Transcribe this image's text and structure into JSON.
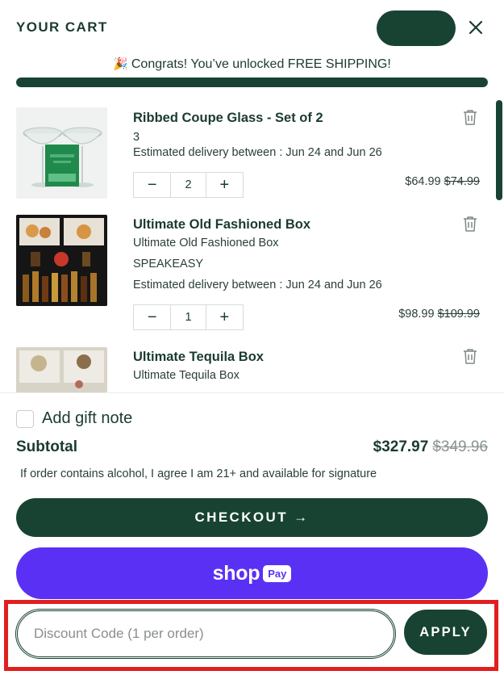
{
  "header": {
    "title": "YOUR CART",
    "close_icon": "close-icon"
  },
  "shipping": {
    "emoji": "🎉",
    "message": "Congrats! You’ve unlocked FREE SHIPPING!",
    "progress_fraction": 1.0
  },
  "items": [
    {
      "name": "Ribbed Coupe Glass - Set of 2",
      "line1": "3",
      "line2": "Estimated delivery between : Jun 24 and Jun 26",
      "quantity": "2",
      "price": "$64.99",
      "compare_price": "$74.99",
      "minus": "−",
      "plus": "+"
    },
    {
      "name": "Ultimate Old Fashioned Box",
      "line1": "Ultimate Old Fashioned Box",
      "line2": "SPEAKEASY",
      "line3": "Estimated delivery between : Jun 24 and Jun 26",
      "quantity": "1",
      "price": "$98.99",
      "compare_price": "$109.99",
      "minus": "−",
      "plus": "+"
    },
    {
      "name": "Ultimate Tequila Box",
      "line1": "Ultimate Tequila Box"
    }
  ],
  "footer": {
    "gift_note_label": "Add gift note",
    "subtotal_label": "Subtotal",
    "subtotal": "$327.97",
    "subtotal_compare": "$349.96",
    "age_notice": "If order contains alcohol, I agree I am 21+ and available for signature",
    "checkout_label": "CHECKOUT →",
    "shoppay_shop": "shop",
    "shoppay_pay": "Pay",
    "discount_placeholder": "Discount Code (1 per order)",
    "apply_label": "APPLY"
  },
  "colors": {
    "brand_green": "#184333",
    "shoppay_purple": "#5a31f4",
    "highlight_red": "#e11f1f"
  }
}
